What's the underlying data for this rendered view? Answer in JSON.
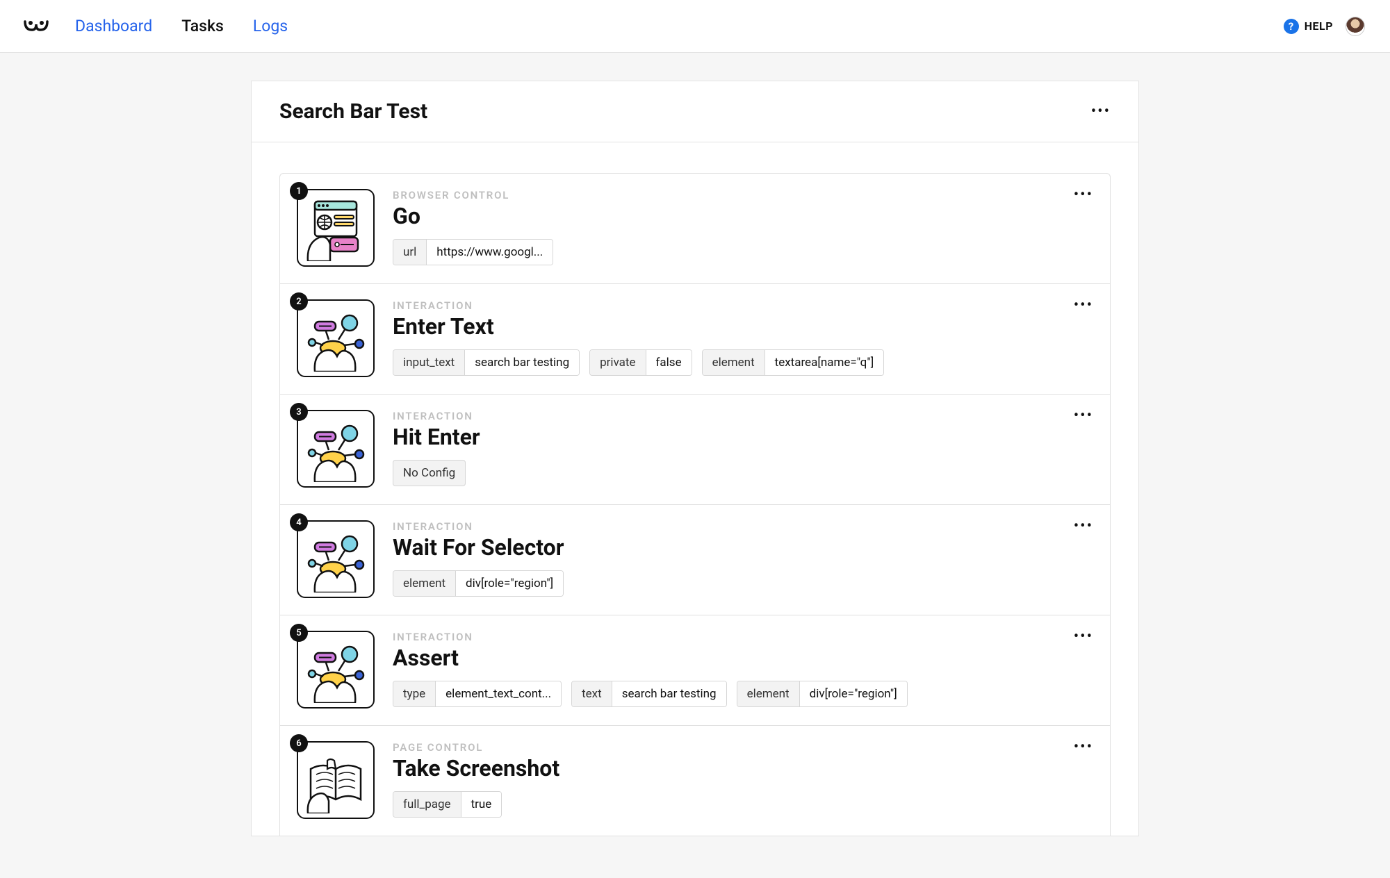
{
  "nav": {
    "dashboard": "Dashboard",
    "tasks": "Tasks",
    "logs": "Logs",
    "help": "HELP"
  },
  "page": {
    "title": "Search Bar Test"
  },
  "steps": [
    {
      "num": "1",
      "category": "BROWSER CONTROL",
      "title": "Go",
      "icon": "browser",
      "params": [
        {
          "k": "url",
          "v": "https://www.googl..."
        }
      ]
    },
    {
      "num": "2",
      "category": "INTERACTION",
      "title": "Enter Text",
      "icon": "interaction",
      "params": [
        {
          "k": "input_text",
          "v": "search bar testing"
        },
        {
          "k": "private",
          "v": "false"
        },
        {
          "k": "element",
          "v": "textarea[name=\"q\"]"
        }
      ]
    },
    {
      "num": "3",
      "category": "INTERACTION",
      "title": "Hit Enter",
      "icon": "interaction",
      "noconfig": "No Config"
    },
    {
      "num": "4",
      "category": "INTERACTION",
      "title": "Wait For Selector",
      "icon": "interaction",
      "params": [
        {
          "k": "element",
          "v": "div[role=\"region\"]"
        }
      ]
    },
    {
      "num": "5",
      "category": "INTERACTION",
      "title": "Assert",
      "icon": "interaction",
      "params": [
        {
          "k": "type",
          "v": "element_text_cont..."
        },
        {
          "k": "text",
          "v": "search bar testing"
        },
        {
          "k": "element",
          "v": "div[role=\"region\"]"
        }
      ]
    },
    {
      "num": "6",
      "category": "PAGE CONTROL",
      "title": "Take Screenshot",
      "icon": "book",
      "params": [
        {
          "k": "full_page",
          "v": "true"
        }
      ]
    }
  ]
}
